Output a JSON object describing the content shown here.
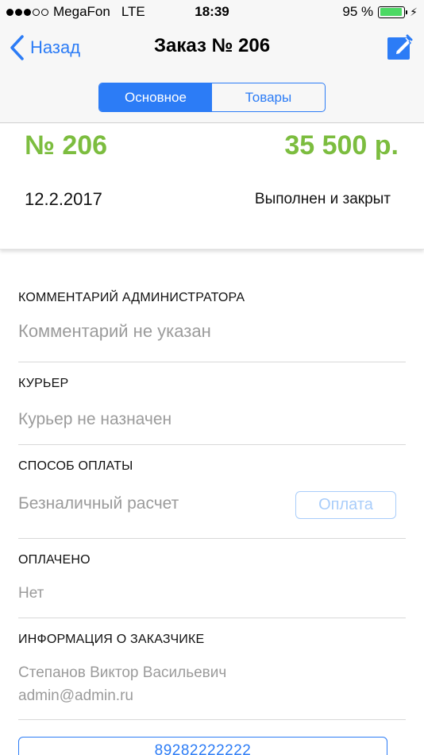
{
  "status_bar": {
    "carrier": "MegaFon",
    "network": "LTE",
    "time": "18:39",
    "battery_text": "95 %",
    "battery_level": 0.95,
    "signal_bars_filled": 3,
    "signal_bars_total": 5
  },
  "nav": {
    "back_label": "Назад",
    "title": "Заказ № 206",
    "edit_icon": "edit-icon",
    "tabs": [
      {
        "label": "Основное",
        "active": true
      },
      {
        "label": "Товары",
        "active": false
      }
    ]
  },
  "summary": {
    "number": "№ 206",
    "total": "35 500 р.",
    "date": "12.2.2017",
    "status": "Выполнен и закрыт"
  },
  "sections": {
    "admin_comment": {
      "label": "КОММЕНТАРИЙ АДМИНИСТРАТОРА",
      "value": "Комментарий не указан"
    },
    "courier": {
      "label": "КУРЬЕР",
      "value": "Курьер не назначен"
    },
    "payment_method": {
      "label": "СПОСОБ ОПЛАТЫ",
      "value": "Безналичный расчет",
      "pay_button": "Оплата"
    },
    "paid": {
      "label": "ОПЛАЧЕНО",
      "value": "Нет"
    },
    "customer": {
      "label": "ИНФОРМАЦИЯ О ЗАКАЗЧИКЕ",
      "name": "Степанов Виктор Васильевич",
      "email": "admin@admin.ru"
    }
  },
  "phone_button": "89282222222",
  "colors": {
    "accent": "#2c7cf6",
    "price_green": "#7cbd3f",
    "muted_text": "#9b9b9b",
    "battery_green": "#4cd964"
  }
}
